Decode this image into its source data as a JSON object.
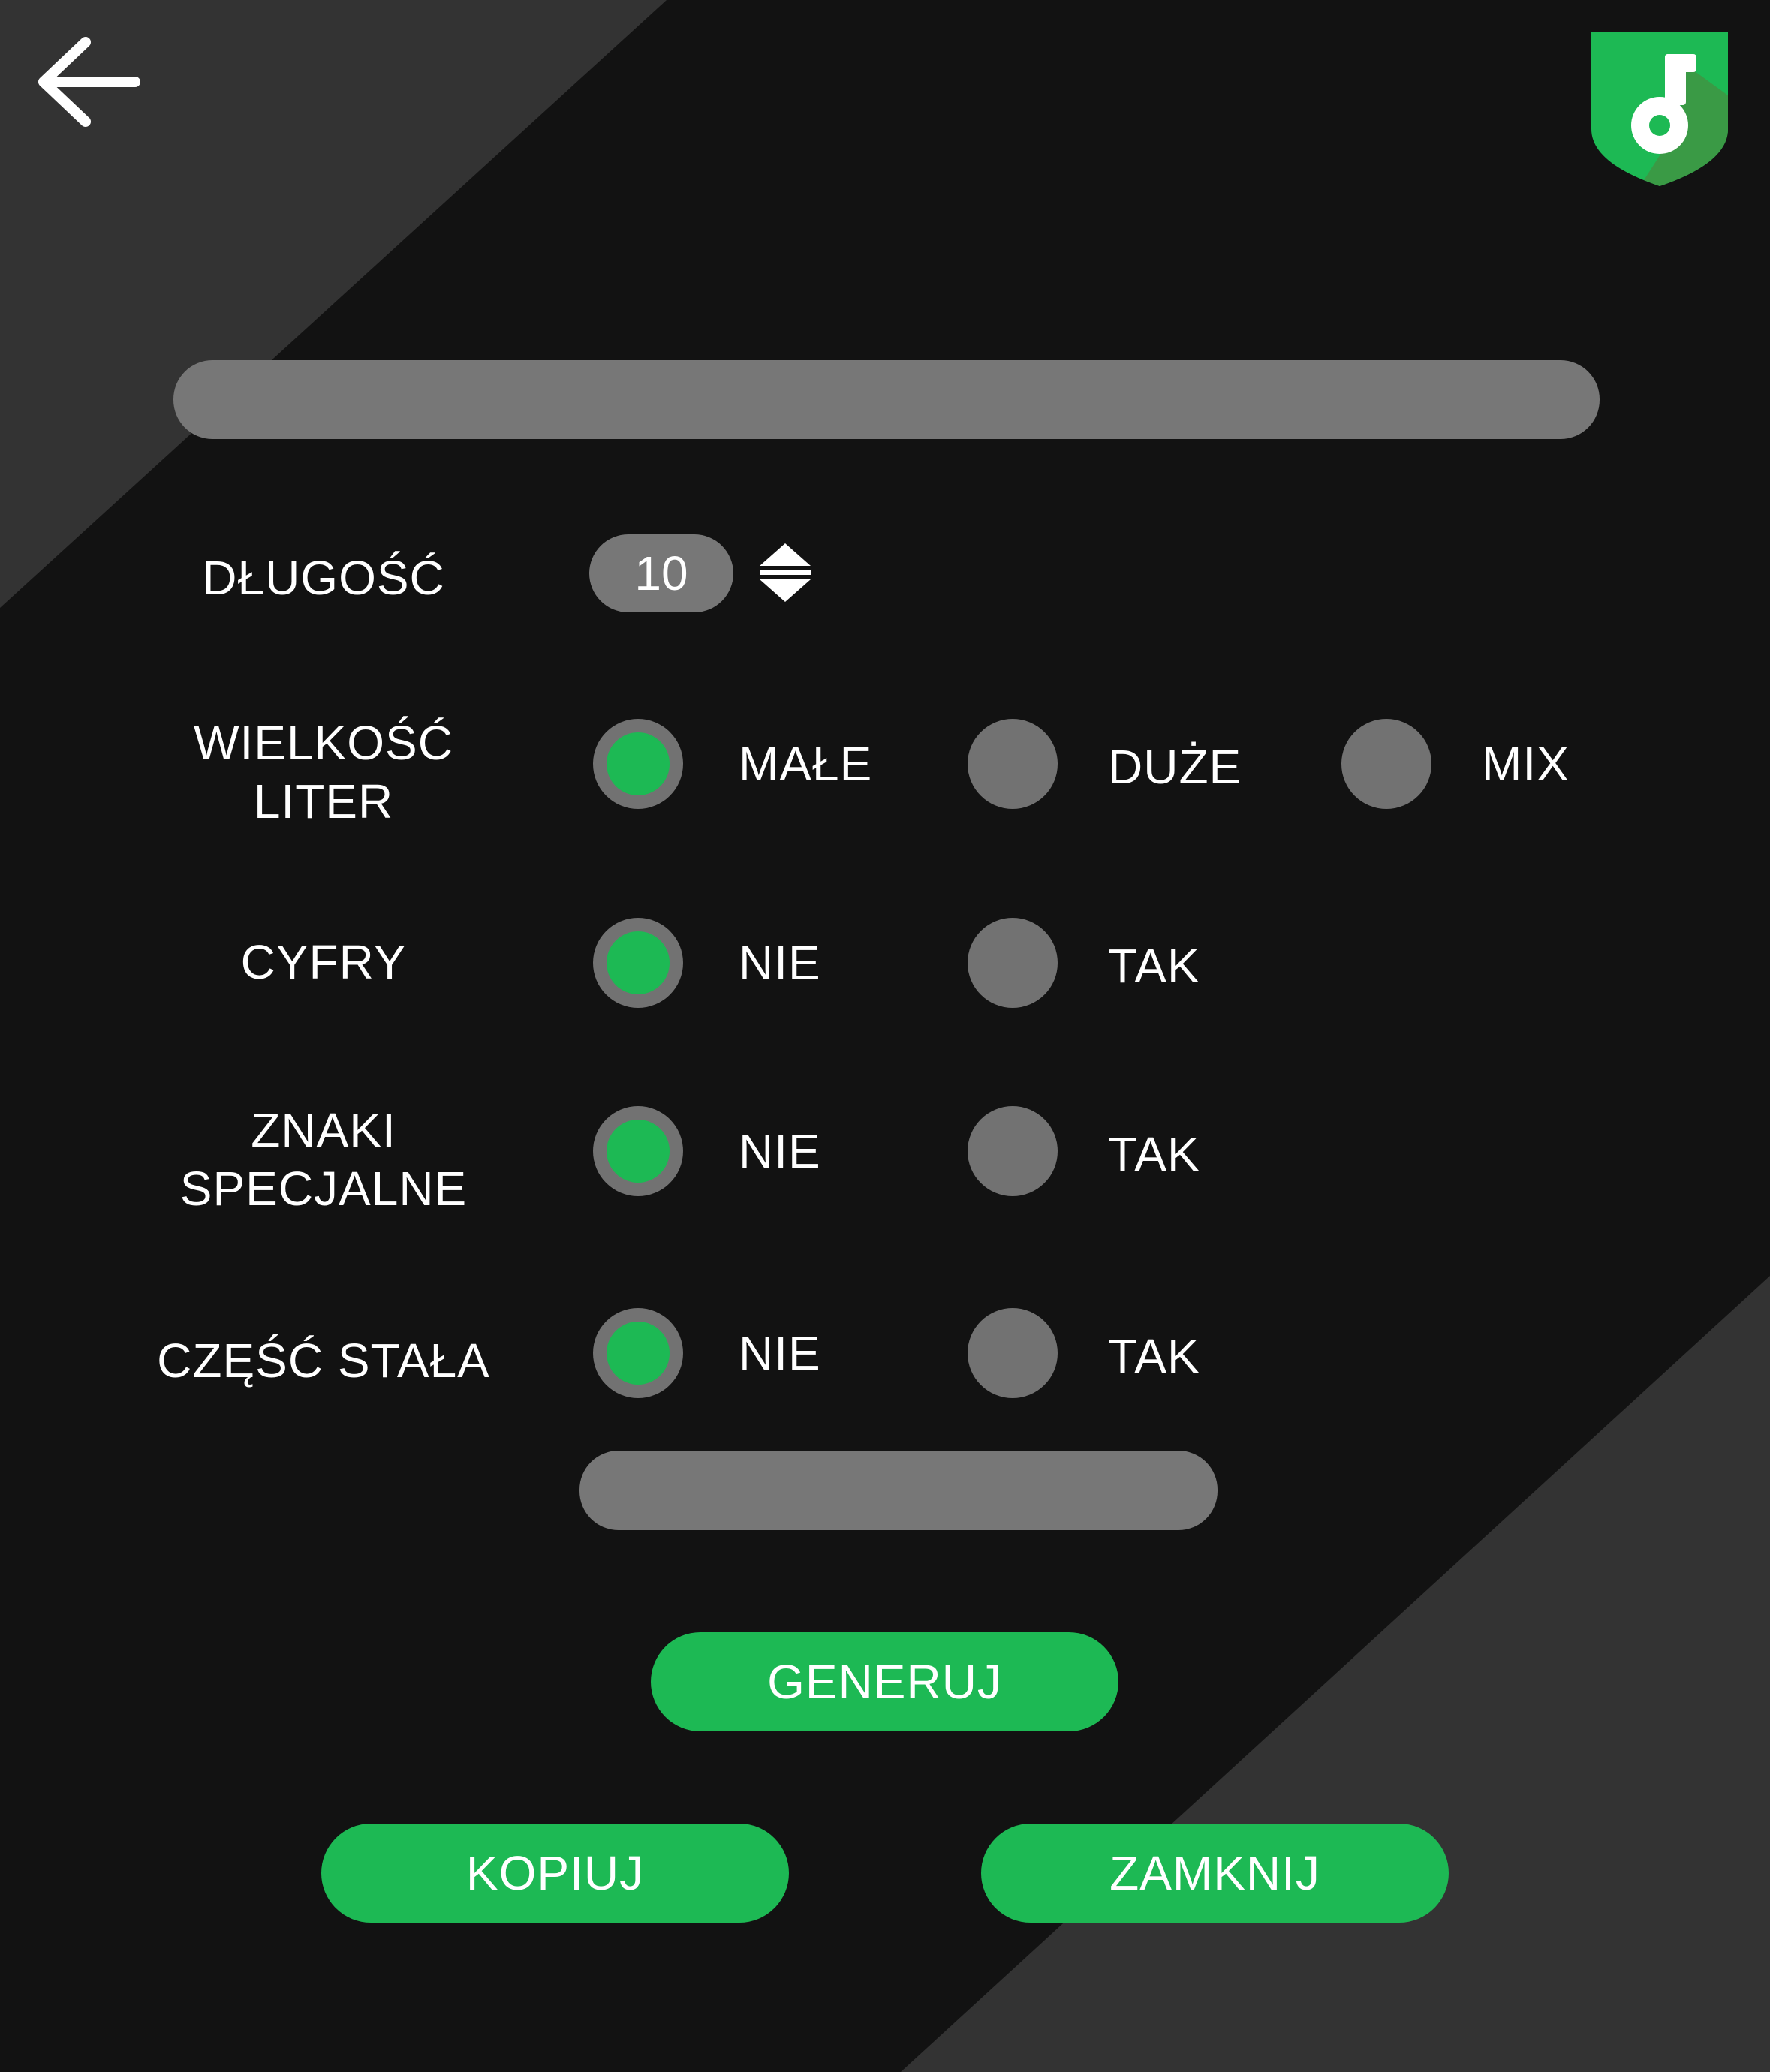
{
  "colors": {
    "background": "#121212",
    "panel": "#333333",
    "accent": "#1db954",
    "control": "#777777"
  },
  "header": {
    "back_icon": "arrow-left-icon",
    "logo_icon": "shield-key-logo"
  },
  "password_output": {
    "value": ""
  },
  "length": {
    "label": "DŁUGOŚĆ",
    "value": "10",
    "spinner_icon": "up-down-spinner-icon"
  },
  "letter_case": {
    "label_line1": "WIELKOŚĆ",
    "label_line2": "LITER",
    "options": [
      {
        "label": "MAŁE",
        "selected": true
      },
      {
        "label": "DUŻE",
        "selected": false
      },
      {
        "label": "MIX",
        "selected": false
      }
    ]
  },
  "digits": {
    "label": "CYFRY",
    "options": [
      {
        "label": "NIE",
        "selected": true
      },
      {
        "label": "TAK",
        "selected": false
      }
    ]
  },
  "special_chars": {
    "label_line1": "ZNAKI",
    "label_line2": "SPECJALNE",
    "options": [
      {
        "label": "NIE",
        "selected": true
      },
      {
        "label": "TAK",
        "selected": false
      }
    ]
  },
  "fixed_part": {
    "label": "CZĘŚĆ STAŁA",
    "options": [
      {
        "label": "NIE",
        "selected": true
      },
      {
        "label": "TAK",
        "selected": false
      }
    ],
    "value": ""
  },
  "buttons": {
    "generate": "GENERUJ",
    "copy": "KOPIUJ",
    "close": "ZAMKNIJ"
  }
}
